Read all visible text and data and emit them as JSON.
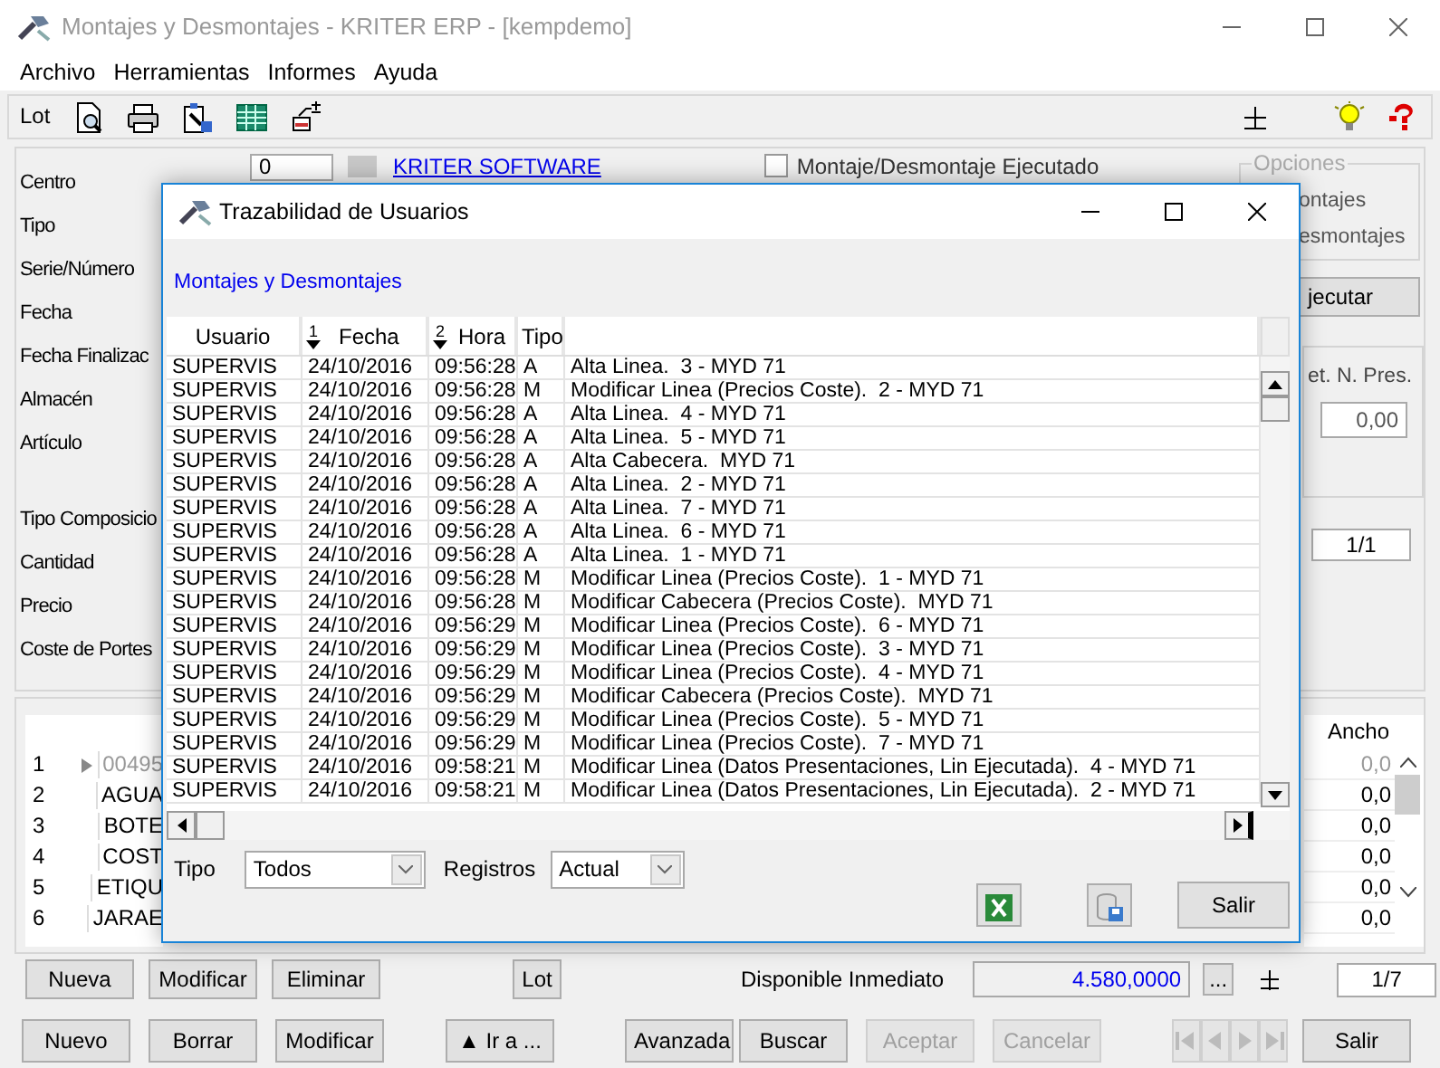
{
  "window": {
    "title": "Montajes y Desmontajes - KRITER ERP - [kempdemo]",
    "active": false
  },
  "menu": [
    "Archivo",
    "Herramientas",
    "Informes",
    "Ayuda"
  ],
  "toolbar": {
    "label": "Lot"
  },
  "form": {
    "top_label": "Centro",
    "centro_value": "0",
    "company_link": "KRITER SOFTWARE",
    "executed_checkbox": {
      "label": "Montaje/Desmontaje Ejecutado",
      "checked": false
    },
    "labels_top": [
      "Tipo",
      "Serie/Número",
      "Fecha",
      "Fecha Finalizac",
      "Almacén",
      "Artículo"
    ],
    "labels_bottom": [
      "Tipo Composicio",
      "Cantidad",
      "Precio",
      "Coste de Portes"
    ]
  },
  "options_group": {
    "legend": "Opciones",
    "items": [
      "ontajes",
      "esmontajes"
    ]
  },
  "execute_button": "jecutar",
  "pres_panel": {
    "label": "et. N. Pres.",
    "value": "0,00"
  },
  "pager_top": "1/1",
  "lines_grid": {
    "right_column": "Ancho",
    "rows": [
      {
        "number": "1",
        "code": "00495",
        "ancho": "0,0",
        "current": true
      },
      {
        "number": "2",
        "code": "AGUA",
        "ancho": "0,0",
        "current": false
      },
      {
        "number": "3",
        "code": "BOTE",
        "ancho": "0,0",
        "current": false
      },
      {
        "number": "4",
        "code": "COST",
        "ancho": "0,0",
        "current": false
      },
      {
        "number": "5",
        "code": "ETIQU",
        "ancho": "0,0",
        "current": false
      },
      {
        "number": "6",
        "code": "JARAE",
        "ancho": "0,0",
        "current": false
      }
    ]
  },
  "line_buttons": [
    "Nueva",
    "Modificar",
    "Eliminar",
    "Lot"
  ],
  "available": {
    "label": "Disponible Inmediato",
    "value": "4.580,0000",
    "more": "...",
    "pager": "1/7"
  },
  "footer_groups": [
    [
      {
        "label": "Nuevo",
        "disabled": false
      },
      {
        "label": "Borrar",
        "disabled": false
      },
      {
        "label": "Modificar",
        "disabled": false
      }
    ],
    [
      {
        "label": "▲ Ir a ...",
        "disabled": false
      }
    ],
    [
      {
        "label": "Avanzada",
        "disabled": false
      },
      {
        "label": "Buscar",
        "disabled": false
      },
      {
        "label": "Aceptar",
        "disabled": true
      },
      {
        "label": "Cancelar",
        "disabled": true
      }
    ]
  ],
  "record_nav": {
    "disabled": true
  },
  "exit_button": "Salir",
  "dialog": {
    "title": "Trazabilidad de Usuarios",
    "link": "Montajes y Desmontajes",
    "columns": [
      {
        "label": "Usuario"
      },
      {
        "label": "Fecha",
        "sort_order": "1"
      },
      {
        "label": "Hora",
        "sort_order": "2"
      },
      {
        "label": "Tipo"
      }
    ],
    "rows": [
      {
        "user": "SUPERVIS",
        "date": "24/10/2016",
        "time": "09:56:28",
        "type": "A",
        "description": "Alta Linea.  3 - MYD 71"
      },
      {
        "user": "SUPERVIS",
        "date": "24/10/2016",
        "time": "09:56:28",
        "type": "M",
        "description": "Modificar Linea (Precios Coste).  2 - MYD 71"
      },
      {
        "user": "SUPERVIS",
        "date": "24/10/2016",
        "time": "09:56:28",
        "type": "A",
        "description": "Alta Linea.  4 - MYD 71"
      },
      {
        "user": "SUPERVIS",
        "date": "24/10/2016",
        "time": "09:56:28",
        "type": "A",
        "description": "Alta Linea.  5 - MYD 71"
      },
      {
        "user": "SUPERVIS",
        "date": "24/10/2016",
        "time": "09:56:28",
        "type": "A",
        "description": "Alta Cabecera.  MYD 71"
      },
      {
        "user": "SUPERVIS",
        "date": "24/10/2016",
        "time": "09:56:28",
        "type": "A",
        "description": "Alta Linea.  2 - MYD 71"
      },
      {
        "user": "SUPERVIS",
        "date": "24/10/2016",
        "time": "09:56:28",
        "type": "A",
        "description": "Alta Linea.  7 - MYD 71"
      },
      {
        "user": "SUPERVIS",
        "date": "24/10/2016",
        "time": "09:56:28",
        "type": "A",
        "description": "Alta Linea.  6 - MYD 71"
      },
      {
        "user": "SUPERVIS",
        "date": "24/10/2016",
        "time": "09:56:28",
        "type": "A",
        "description": "Alta Linea.  1 - MYD 71"
      },
      {
        "user": "SUPERVIS",
        "date": "24/10/2016",
        "time": "09:56:28",
        "type": "M",
        "description": "Modificar Linea (Precios Coste).  1 - MYD 71"
      },
      {
        "user": "SUPERVIS",
        "date": "24/10/2016",
        "time": "09:56:28",
        "type": "M",
        "description": "Modificar Cabecera (Precios Coste).  MYD 71"
      },
      {
        "user": "SUPERVIS",
        "date": "24/10/2016",
        "time": "09:56:29",
        "type": "M",
        "description": "Modificar Linea (Precios Coste).  6 - MYD 71"
      },
      {
        "user": "SUPERVIS",
        "date": "24/10/2016",
        "time": "09:56:29",
        "type": "M",
        "description": "Modificar Linea (Precios Coste).  3 - MYD 71"
      },
      {
        "user": "SUPERVIS",
        "date": "24/10/2016",
        "time": "09:56:29",
        "type": "M",
        "description": "Modificar Linea (Precios Coste).  4 - MYD 71"
      },
      {
        "user": "SUPERVIS",
        "date": "24/10/2016",
        "time": "09:56:29",
        "type": "M",
        "description": "Modificar Cabecera (Precios Coste).  MYD 71"
      },
      {
        "user": "SUPERVIS",
        "date": "24/10/2016",
        "time": "09:56:29",
        "type": "M",
        "description": "Modificar Linea (Precios Coste).  5 - MYD 71"
      },
      {
        "user": "SUPERVIS",
        "date": "24/10/2016",
        "time": "09:56:29",
        "type": "M",
        "description": "Modificar Linea (Precios Coste).  7 - MYD 71"
      },
      {
        "user": "SUPERVIS",
        "date": "24/10/2016",
        "time": "09:58:21",
        "type": "M",
        "description": "Modificar Linea (Datos Presentaciones, Lin Ejecutada).  4 - MYD 71"
      },
      {
        "user": "SUPERVIS",
        "date": "24/10/2016",
        "time": "09:58:21",
        "type": "M",
        "description": "Modificar Linea (Datos Presentaciones, Lin Ejecutada).  2 - MYD 71"
      }
    ],
    "filters": [
      {
        "label": "Tipo",
        "value": "Todos"
      },
      {
        "label": "Registros",
        "value": "Actual"
      }
    ],
    "close_button": "Salir"
  }
}
